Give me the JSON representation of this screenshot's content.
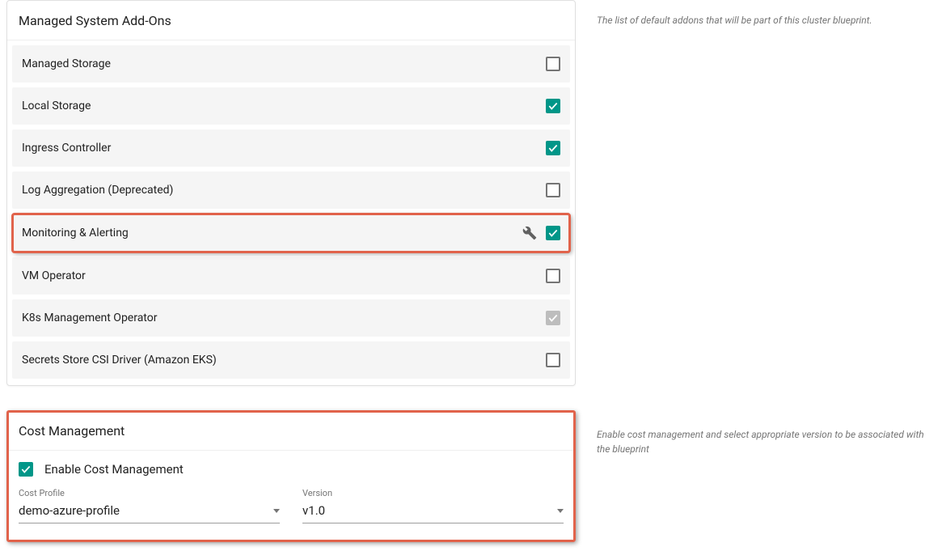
{
  "addons_section": {
    "title": "Managed System Add-Ons",
    "description": "The list of default addons that will be part of this cluster blueprint.",
    "items": [
      {
        "label": "Managed Storage",
        "checked": false,
        "wrench": false,
        "disabled": false,
        "highlighted": false
      },
      {
        "label": "Local Storage",
        "checked": true,
        "wrench": false,
        "disabled": false,
        "highlighted": false
      },
      {
        "label": "Ingress Controller",
        "checked": true,
        "wrench": false,
        "disabled": false,
        "highlighted": false
      },
      {
        "label": "Log Aggregation (Deprecated)",
        "checked": false,
        "wrench": false,
        "disabled": false,
        "highlighted": false
      },
      {
        "label": "Monitoring & Alerting",
        "checked": true,
        "wrench": true,
        "disabled": false,
        "highlighted": true
      },
      {
        "label": "VM Operator",
        "checked": false,
        "wrench": false,
        "disabled": false,
        "highlighted": false
      },
      {
        "label": "K8s Management Operator",
        "checked": true,
        "wrench": false,
        "disabled": true,
        "highlighted": false
      },
      {
        "label": "Secrets Store CSI Driver (Amazon EKS)",
        "checked": false,
        "wrench": false,
        "disabled": false,
        "highlighted": false
      }
    ]
  },
  "cost_section": {
    "title": "Cost Management",
    "description": "Enable cost management and select appropriate version to be associated with the blueprint",
    "enable_label": "Enable Cost Management",
    "enable_checked": true,
    "cost_profile_label": "Cost Profile",
    "cost_profile_value": "demo-azure-profile",
    "version_label": "Version",
    "version_value": "v1.0",
    "highlighted": true
  }
}
